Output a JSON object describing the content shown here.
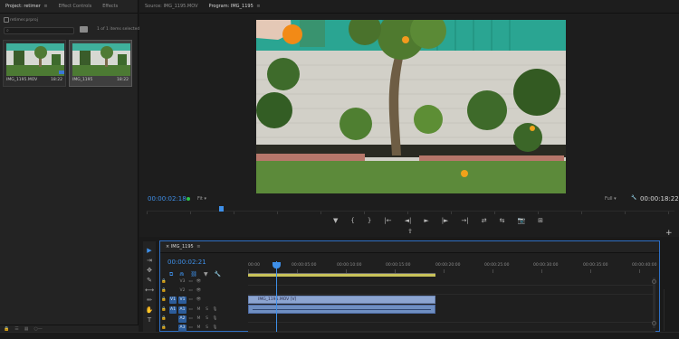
{
  "project_panel": {
    "tabs": [
      "Project: retimer",
      "Effect Controls",
      "Effects"
    ],
    "project_file": "retimer.prproj",
    "search_placeholder": "",
    "selection_info": "1 of 1 items selected",
    "items": [
      {
        "name": "IMG_1195.MOV",
        "duration": "18:22"
      },
      {
        "name": "IMG_1195",
        "duration": "18:22"
      }
    ]
  },
  "monitor": {
    "tabs": [
      "Source: IMG_1195.MOV",
      "Program: IMG_1195"
    ],
    "timecode_current": "00:00:02:18",
    "fit_label": "Fit",
    "quality_label": "Full",
    "timecode_total": "00:00:18:22",
    "transport": [
      "▼",
      "{",
      "}",
      "|←",
      "◄|",
      "►",
      "|►",
      "→|",
      "⇄",
      "⇆",
      "📷",
      "⊞"
    ],
    "export_icon": "⇪",
    "add_button": "+"
  },
  "tools": [
    "▶",
    "⇥",
    "✥",
    "✎",
    "⟷",
    "✏",
    "✋",
    "T"
  ],
  "timeline": {
    "tab": "IMG_1195",
    "timecode": "00:00:02:21",
    "ruler_labels": [
      "00:00",
      "00:00:05:00",
      "00:00:10:00",
      "00:00:15:00",
      "00:00:20:00",
      "00:00:25:00",
      "00:00:30:00",
      "00:00:35:00",
      "00:00:40:00"
    ],
    "video_tracks": [
      {
        "name": "V3"
      },
      {
        "name": "V2"
      },
      {
        "name": "V1"
      }
    ],
    "audio_tracks": [
      {
        "name": "A1",
        "m": "M",
        "s": "S"
      },
      {
        "name": "A2",
        "m": "M",
        "s": "S"
      },
      {
        "name": "A3",
        "m": "M",
        "s": "S"
      }
    ],
    "video_clip_label": "IMG_1195.MOV [V]",
    "playhead_fraction_of_clip": 0.15
  },
  "colors": {
    "accent": "#3e8fe8",
    "video_clip": "#8ca5d1",
    "audio_clip": "#6f8fc2",
    "work_area": "#c9c35a",
    "target_on": "#2c5c9a"
  }
}
